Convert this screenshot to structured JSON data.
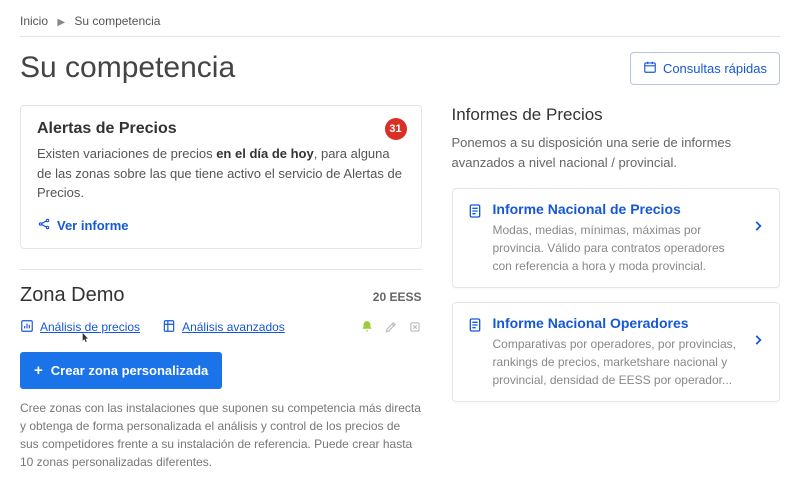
{
  "breadcrumb": {
    "home": "Inicio",
    "current": "Su competencia"
  },
  "page_title": "Su competencia",
  "quick_queries_btn": "Consultas rápidas",
  "alert_card": {
    "title": "Alertas de Precios",
    "badge": "31",
    "text_before": "Existen variaciones de precios ",
    "text_bold": "en el día de hoy",
    "text_after": ", para alguna de las zonas sobre las que tiene activo el servicio de Alertas de Precios.",
    "link": "Ver informe"
  },
  "zone": {
    "title": "Zona Demo",
    "count": "20 EESS",
    "analysis_prices": "Análisis de precios",
    "analysis_advanced": "Análisis avanzados"
  },
  "create_zone_btn": "Crear zona personalizada",
  "help_text": "Cree zonas con las instalaciones que suponen su competencia más directa y obtenga de forma personalizada el análisis y control de los precios de sus competidores frente a su instalación de referencia. Puede crear hasta 10 zonas personalizadas diferentes.",
  "reports": {
    "heading": "Informes de Precios",
    "intro": "Ponemos a su disposición una serie de informes avanzados a nivel nacional / provincial.",
    "items": [
      {
        "title": "Informe Nacional de Precios",
        "desc": "Modas, medias, mínimas, máximas por provincia. Válido para contratos operadores con referencia a hora y moda provincial."
      },
      {
        "title": "Informe Nacional Operadores",
        "desc": "Comparativas por operadores, por provincias, rankings de precios, marketshare nacional y provincial, densidad de EESS por operador..."
      }
    ]
  }
}
